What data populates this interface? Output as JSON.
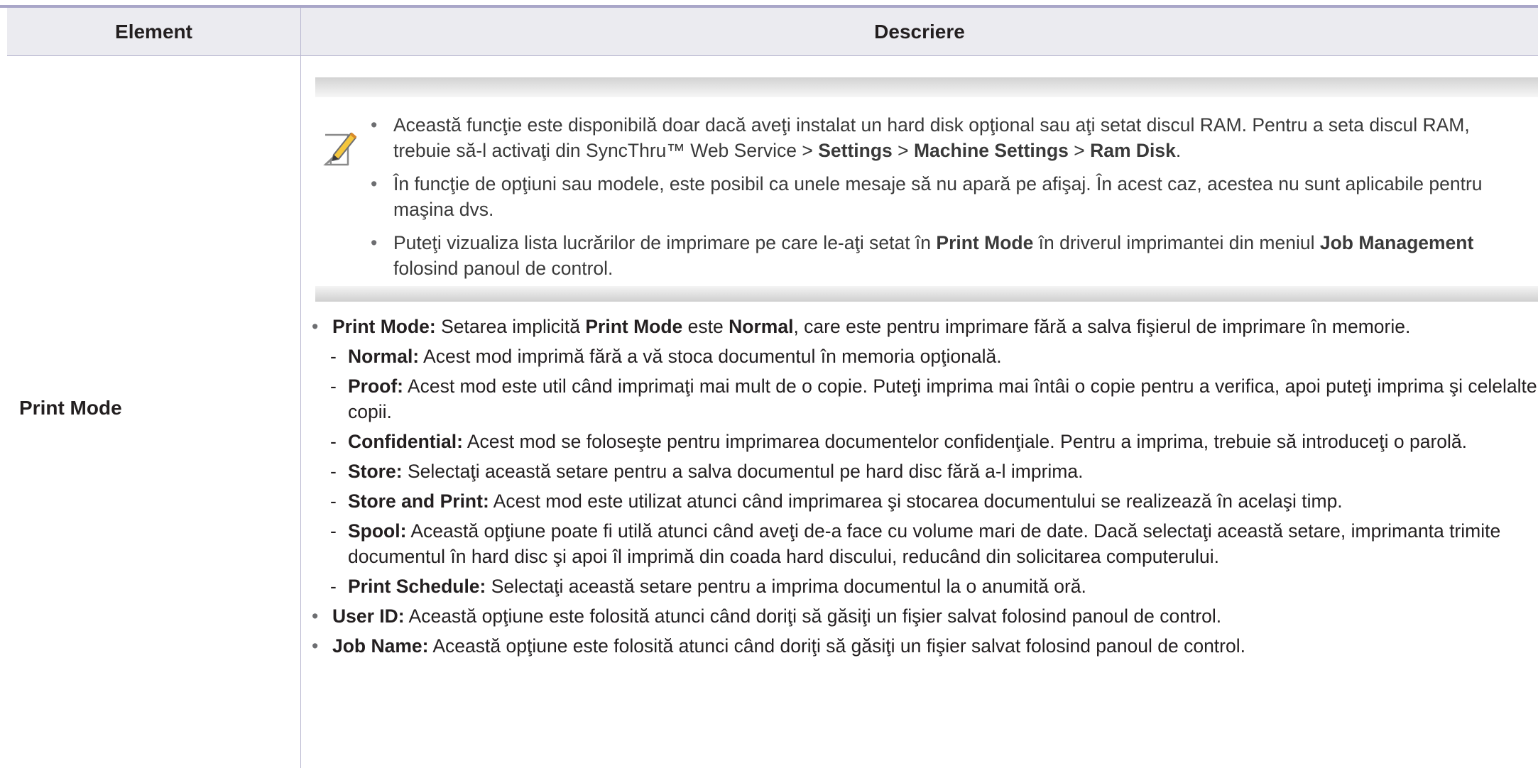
{
  "table": {
    "headers": {
      "element": "Element",
      "description": "Descriere"
    },
    "row_label": "Print Mode"
  },
  "note": {
    "icon": "pencil-note-icon",
    "bullets": [
      {
        "t1": "Această funcţie este disponibilă doar dacă aveţi instalat un hard disk opţional sau aţi setat discul RAM. Pentru a seta discul RAM, trebuie să-l activaţi din SyncThru™ Web Service > ",
        "b1": "Settings",
        "sep1": " > ",
        "b2": "Machine Settings",
        "sep2": " > ",
        "b3": "Ram Disk",
        "end": "."
      },
      {
        "text": "În funcţie de opţiuni sau modele, este posibil ca unele mesaje să nu apară pe afişaj. În acest caz, acestea nu sunt aplicabile pentru maşina dvs."
      },
      {
        "t1": "Puteţi vizualiza lista lucrărilor de imprimare pe care le-aţi setat în ",
        "b1": "Print Mode",
        "t2": " în driverul imprimantei din meniul ",
        "b2": "Job Management",
        "t3": " folosind panoul de control."
      }
    ]
  },
  "print_mode": {
    "label": "Print Mode:",
    "t1": " Setarea implicită ",
    "b1": "Print Mode",
    "t2": " este ",
    "b2": "Normal",
    "t3": ", care este pentru imprimare fără a salva fişierul de imprimare în memorie.",
    "sub": [
      {
        "label": "Normal:",
        "text": " Acest mod imprimă fără a vă stoca documentul în memoria opţională."
      },
      {
        "label": "Proof:",
        "text": " Acest mod este util când imprimaţi mai mult de o copie. Puteţi imprima mai întâi o copie pentru a verifica, apoi puteţi imprima şi celelalte copii."
      },
      {
        "label": "Confidential:",
        "text": " Acest mod se foloseşte pentru imprimarea documentelor confidenţiale. Pentru a imprima, trebuie să introduceţi o parolă."
      },
      {
        "label": "Store:",
        "text": " Selectaţi această setare pentru a salva documentul pe hard disc fără a-l imprima."
      },
      {
        "label": "Store and Print:",
        "text": " Acest mod este utilizat atunci când imprimarea şi stocarea documentului se realizează în acelaşi timp."
      },
      {
        "label": "Spool:",
        "text": " Această opţiune poate fi utilă atunci când aveţi de-a face cu volume mari de date. Dacă selectaţi această setare, imprimanta trimite documentul în hard disc şi apoi îl imprimă din coada hard discului, reducând din solicitarea computerului."
      },
      {
        "label": "Print Schedule:",
        "text": " Selectaţi această setare pentru a imprima documentul la o anumită oră."
      }
    ]
  },
  "user_id": {
    "label": "User ID:",
    "text": " Această opţiune este folosită atunci când doriţi să găsiţi un fişier salvat folosind panoul de control."
  },
  "job_name": {
    "label": "Job Name:",
    "text": " Această opţiune este folosită atunci când doriţi să găsiţi un fişier salvat folosind panoul de control."
  }
}
